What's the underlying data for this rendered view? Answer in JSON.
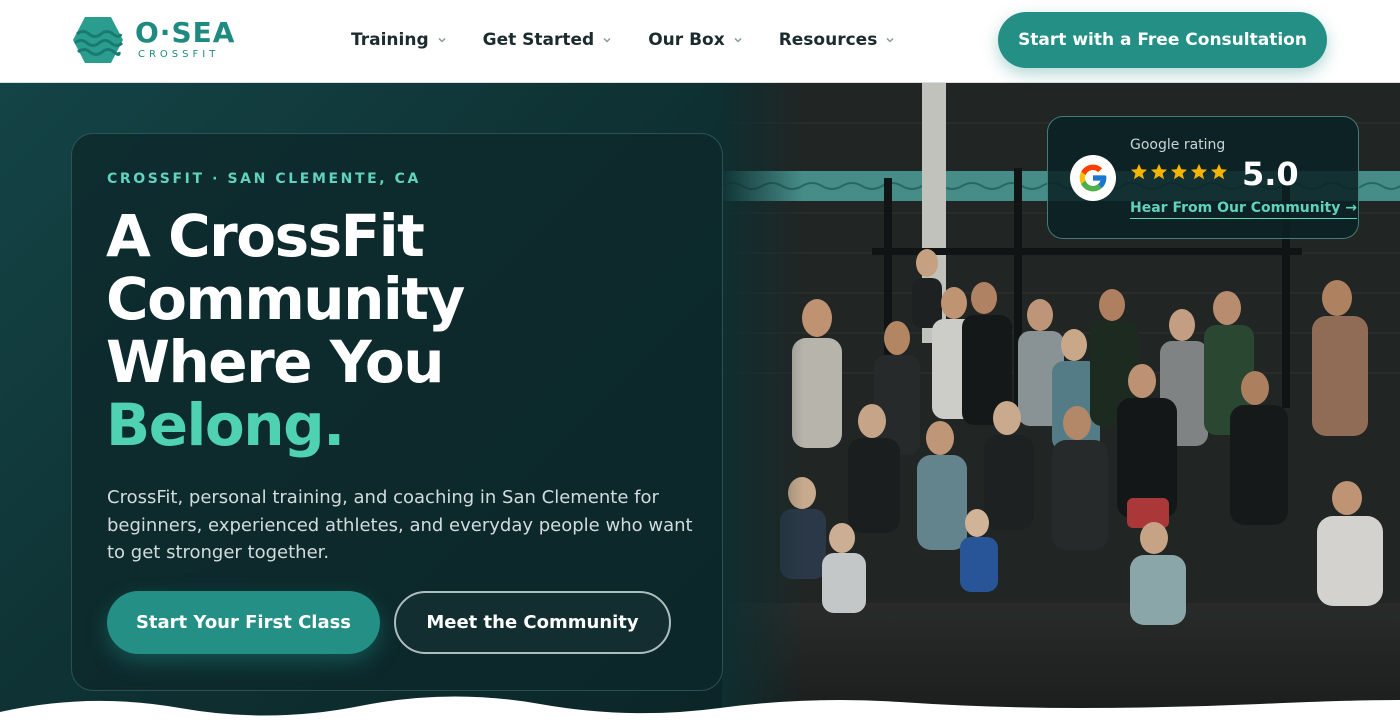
{
  "brand": {
    "name": "O·SEA",
    "tagline": "CROSSFIT",
    "color_primary": "#238f85",
    "color_accent": "#4fd2b2"
  },
  "nav": {
    "items": [
      {
        "label": "Training",
        "icon": "chevron-down-icon"
      },
      {
        "label": "Get Started",
        "icon": "chevron-down-icon"
      },
      {
        "label": "Our Box",
        "icon": "chevron-down-icon"
      },
      {
        "label": "Resources",
        "icon": "chevron-down-icon"
      }
    ],
    "cta_label": "Start with a Free Consultation"
  },
  "hero": {
    "eyebrow": "CROSSFIT · SAN CLEMENTE, CA",
    "headline_lines": [
      "A CrossFit",
      "Community",
      "Where You"
    ],
    "headline_accent": "Belong.",
    "subtext": "CrossFit, personal training, and coaching in San Clemente for beginners, experienced athletes, and everyday people who want to get stronger together.",
    "primary_button": "Start Your First Class",
    "secondary_button": "Meet the Community",
    "photo_icon": "group-photo-image"
  },
  "rating": {
    "label": "Google rating",
    "stars": 5,
    "score": "5.0",
    "link_label": "Hear From Our Community →",
    "icon": "google-logo-icon",
    "star_color": "#f5b400"
  }
}
